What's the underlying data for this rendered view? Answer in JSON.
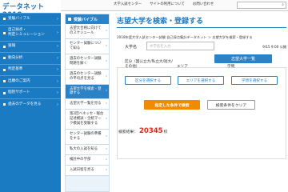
{
  "logo": {
    "text": "データネット2018"
  },
  "leftnav": {
    "items": [
      {
        "label": "受験バイブル"
      },
      {
        "label": "自己採点・\n判定シミュレーション"
      },
      {
        "label": "速報"
      },
      {
        "label": "動向分析"
      },
      {
        "label": "判定基準"
      },
      {
        "label": "出願のご案内"
      },
      {
        "label": "個別サポート"
      },
      {
        "label": "過去のデータを見る"
      }
    ]
  },
  "topbar": {
    "links": [
      "大学入試センター",
      "サイトの利用について",
      "お問い合わせ"
    ]
  },
  "sidebar": {
    "heading": "受験バイブル",
    "items": [
      {
        "label": "志望大合格に向けてのスケジュール",
        "active": false
      },
      {
        "label": "センター試験について知る",
        "active": false
      },
      {
        "label": "過去のセンター試験問題を解く",
        "active": false
      },
      {
        "label": "過去のセンター試験の平均点を見る",
        "active": false
      },
      {
        "label": "志望大学を検索・登録する",
        "active": true
      },
      {
        "label": "志望大学一覧を見る",
        "active": false
      },
      {
        "label": "第2回ベネッセ・駿台記述模試・全統マーク模試を受験する",
        "active": false
      },
      {
        "label": "センター試験の準備をする",
        "active": false
      },
      {
        "label": "私大の入試を知る",
        "active": false
      },
      {
        "label": "検討中の学部",
        "active": false
      },
      {
        "label": "入試日程を見る",
        "active": false
      }
    ]
  },
  "main": {
    "title": "志望大学を検索・登録する",
    "breadcrumb": "2018年度大学入試センター試験 自己採点集計データネット ＞ 志望大学を検索・登録する",
    "date": "9/15 9:00 公開",
    "list_button": "志望大学一覧",
    "name_label": "大学名",
    "name_placeholder": "大学名を入力",
    "category_label": "区分（国公立大/私立大/短大/その他）",
    "area_label": "エリア",
    "dept_label": "学問",
    "category_select": "区分を選択する",
    "area_select": "エリアを選択する",
    "dept_select": "学問を選択する",
    "search_button": "指定した条件で検索",
    "clear_button": "検索条件をクリア",
    "results_label": "検索結果：",
    "results_count": "20345",
    "results_unit": "校"
  }
}
